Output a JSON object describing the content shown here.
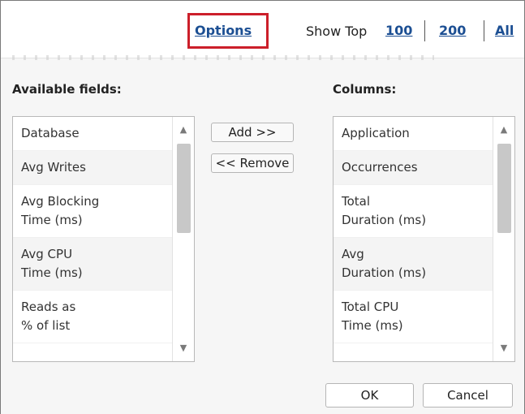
{
  "header": {
    "options_label": "Options",
    "show_top_label": "Show Top",
    "top_options": [
      "100",
      "200",
      "All"
    ]
  },
  "available": {
    "title": "Available fields:",
    "items": [
      "Database",
      "Avg Writes",
      "Avg Blocking\nTime (ms)",
      "Avg CPU\nTime (ms)",
      "Reads as\n% of list"
    ]
  },
  "columns": {
    "title": "Columns:",
    "items": [
      "Application",
      "Occurrences",
      "Total\nDuration (ms)",
      "Avg\nDuration (ms)",
      "Total CPU\nTime (ms)"
    ]
  },
  "actions": {
    "add_label": "Add >>",
    "remove_label": "<< Remove",
    "ok_label": "OK",
    "cancel_label": "Cancel"
  },
  "icons": {
    "scroll_up": "triangle-up",
    "scroll_down": "triangle-down"
  },
  "colors": {
    "link": "#1c4f93",
    "highlight_border": "#cc1f2a"
  }
}
